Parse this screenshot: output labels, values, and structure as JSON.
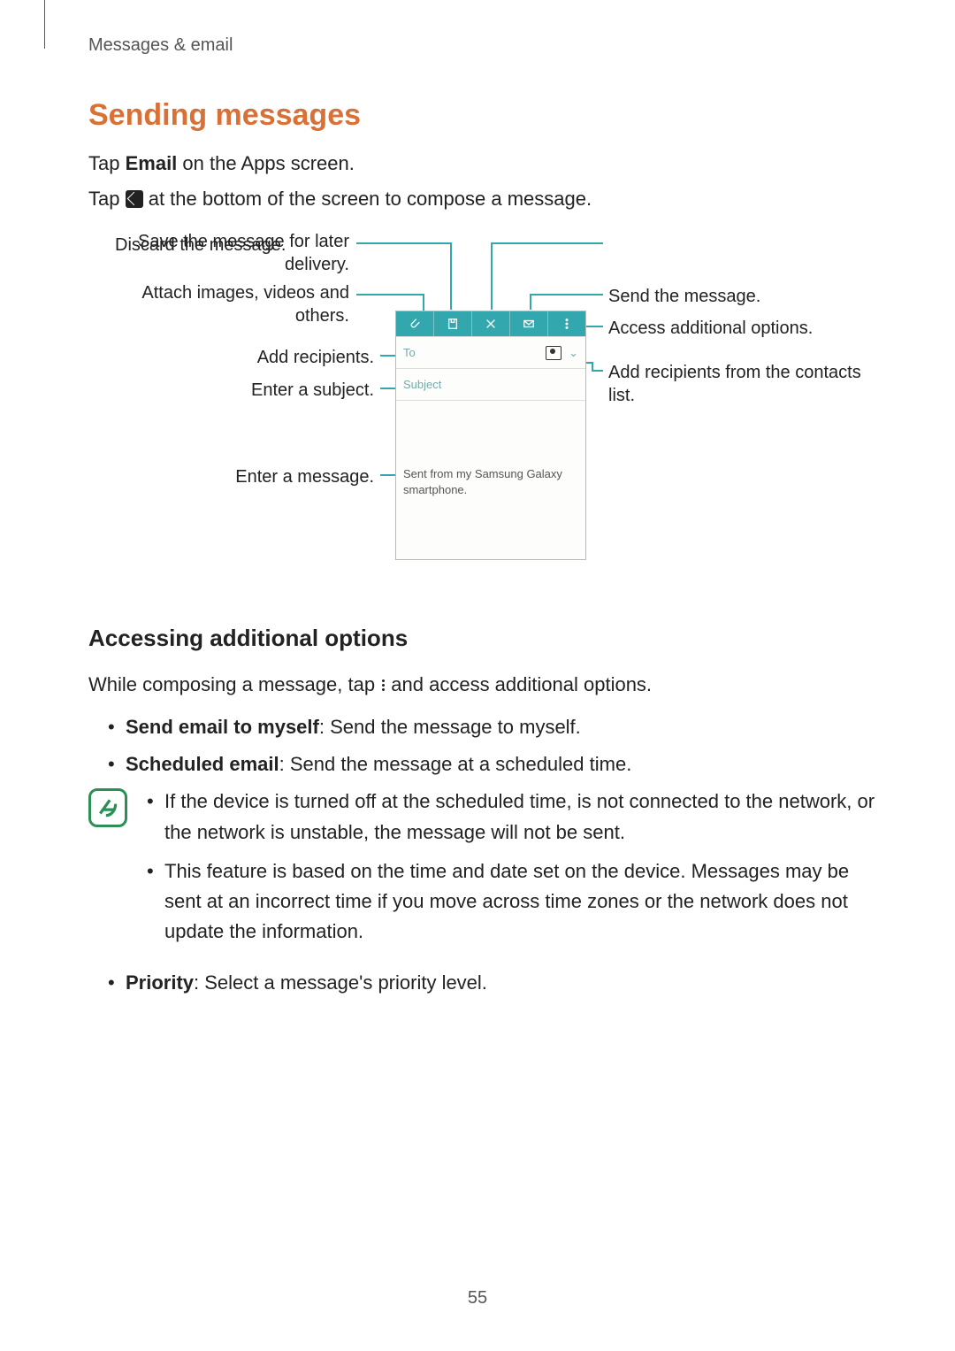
{
  "breadcrumb": "Messages & email",
  "heading": "Sending messages",
  "intro_prefix": "Tap ",
  "intro_bold": "Email",
  "intro_suffix": " on the Apps screen.",
  "intro2_prefix": "Tap ",
  "intro2_suffix": " at the bottom of the screen to compose a message.",
  "diagram": {
    "left": {
      "save": "Save the message for later delivery.",
      "attach": "Attach images, videos and others.",
      "recipients": "Add recipients.",
      "subject": "Enter a subject.",
      "message": "Enter a message."
    },
    "right": {
      "discard": "Discard the message.",
      "send": "Send the message.",
      "more": "Access additional options.",
      "contacts": "Add recipients from the contacts list."
    },
    "phone": {
      "to": "To",
      "subject": "Subject",
      "body": "Sent from my Samsung Galaxy smartphone."
    }
  },
  "subheading": "Accessing additional options",
  "sub_para_prefix": "While composing a message, tap ",
  "sub_para_suffix": " and access additional options.",
  "options": [
    {
      "term": "Send email to myself",
      "desc": ": Send the message to myself."
    },
    {
      "term": "Scheduled email",
      "desc": ": Send the message at a scheduled time."
    }
  ],
  "notes": [
    "If the device is turned off at the scheduled time, is not connected to the network, or the network is unstable, the message will not be sent.",
    "This feature is based on the time and date set on the device. Messages may be sent at an incorrect time if you move across time zones or the network does not update the information."
  ],
  "option_after": {
    "term": "Priority",
    "desc": ": Select a message's priority level."
  },
  "page_number": "55"
}
